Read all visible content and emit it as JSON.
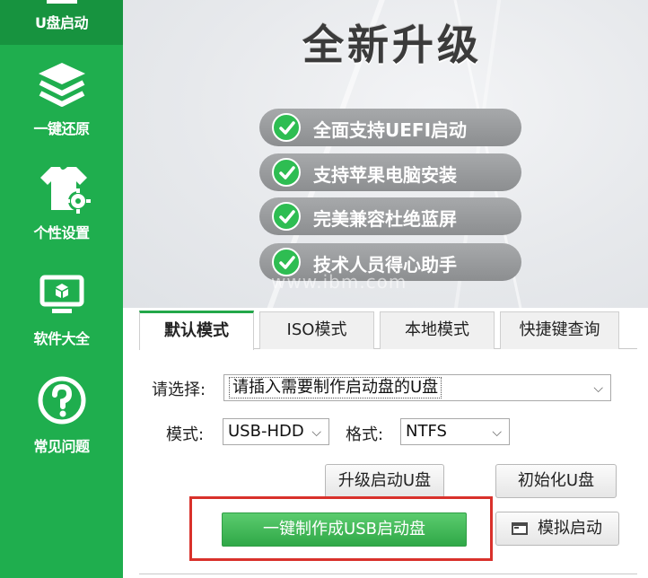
{
  "sidebar": {
    "items": [
      {
        "label": "U盘启动",
        "icon": "usb-icon"
      },
      {
        "label": "一键还原",
        "icon": "layers-icon"
      },
      {
        "label": "个性设置",
        "icon": "shirt-gear-icon"
      },
      {
        "label": "软件大全",
        "icon": "monitor-icon"
      },
      {
        "label": "常见问题",
        "icon": "help-icon"
      }
    ]
  },
  "banner": {
    "title": "全新升级",
    "features": [
      "全面支持UEFI启动",
      "支持苹果电脑安装",
      "完美兼容杜绝蓝屏",
      "技术人员得心助手"
    ],
    "watermark": "www.ibm.com"
  },
  "tabs": [
    {
      "label": "默认模式",
      "active": true
    },
    {
      "label": "ISO模式",
      "active": false
    },
    {
      "label": "本地模式",
      "active": false
    },
    {
      "label": "快捷键查询",
      "active": false
    }
  ],
  "form": {
    "select_label": "请选择:",
    "device_value": "请插入需要制作启动盘的U盘",
    "mode_label": "模式:",
    "mode_value": "USB-HDD",
    "format_label": "格式:",
    "format_value": "NTFS"
  },
  "buttons": {
    "upgrade": "升级启动U盘",
    "initialize": "初始化U盘",
    "create": "一键制作成USB启动盘",
    "simulate": "模拟启动"
  },
  "colors": {
    "sidebar_green": "#1fae4e",
    "check_green": "#2ebd52",
    "highlight_red": "#d9312b"
  }
}
